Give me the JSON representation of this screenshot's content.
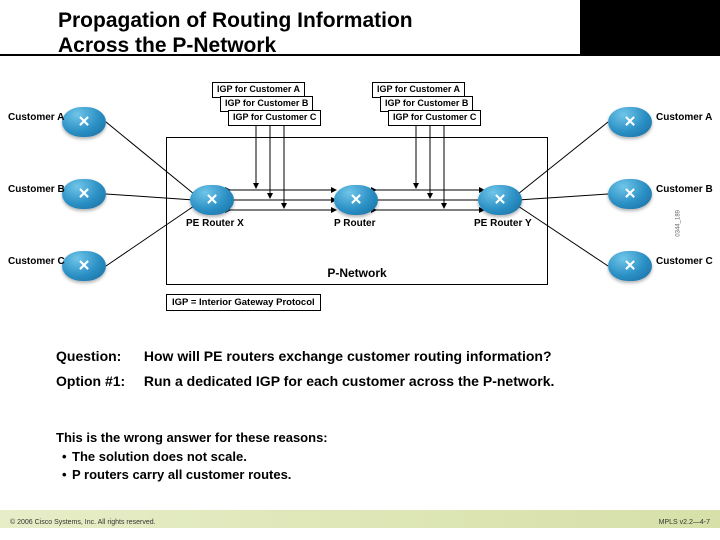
{
  "header": {
    "title_line1": "Propagation of Routing Information",
    "title_line2": "Across the P-Network"
  },
  "routers": {
    "left": [
      {
        "label": "Customer A"
      },
      {
        "label": "Customer B"
      },
      {
        "label": "Customer C"
      }
    ],
    "right": [
      {
        "label": "Customer A"
      },
      {
        "label": "Customer B"
      },
      {
        "label": "Customer C"
      }
    ],
    "core": [
      {
        "label": "PE Router X"
      },
      {
        "label": "P Router"
      },
      {
        "label": "PE Router Y"
      }
    ]
  },
  "igp_labels": {
    "a": "IGP for Customer A",
    "b": "IGP for Customer B",
    "c": "IGP for Customer C"
  },
  "pnetwork_label": "P-Network",
  "glossary": "IGP = Interior Gateway Protocol",
  "qa": {
    "q_label": "Question:",
    "q_text": "How will PE routers exchange customer routing information?",
    "o_label": "Option #1:",
    "o_text": "Run a dedicated IGP for each customer across the P-network."
  },
  "wrong": {
    "heading": "This is the wrong answer for these reasons:",
    "reasons": [
      "The solution does not scale.",
      "P routers carry all customer routes."
    ]
  },
  "footer": {
    "copyright": "© 2006 Cisco Systems, Inc. All rights reserved.",
    "slide_ref": "MPLS v2.2—4-7",
    "side_code": "0344_189"
  }
}
